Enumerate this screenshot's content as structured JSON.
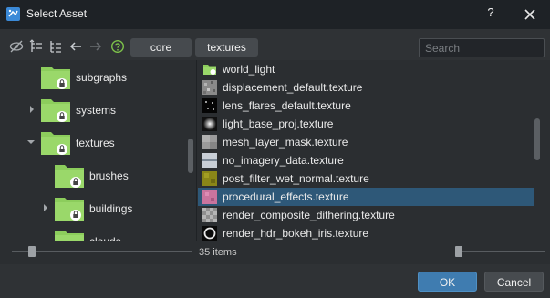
{
  "window": {
    "title": "Select Asset",
    "help_label": "?"
  },
  "toolbar": {
    "icons": [
      "hide-icon",
      "expand-tree-icon",
      "collapse-tree-icon",
      "back-arrow-icon",
      "forward-arrow-icon",
      "help-circle-icon"
    ],
    "breadcrumbs": [
      "core",
      "textures"
    ],
    "search_placeholder": "Search"
  },
  "tree": {
    "items": [
      {
        "label": "subgraphs",
        "expanded": null
      },
      {
        "label": "systems",
        "expanded": false
      },
      {
        "label": "textures",
        "expanded": true
      },
      {
        "label": "brushes",
        "expanded": null
      },
      {
        "label": "buildings",
        "expanded": false
      },
      {
        "label": "clouds",
        "expanded": null
      }
    ]
  },
  "list": {
    "items": [
      {
        "label": "world_light",
        "thumb": "folder"
      },
      {
        "label": "displacement_default.texture",
        "thumb": "noise"
      },
      {
        "label": "lens_flares_default.texture",
        "thumb": "dots"
      },
      {
        "label": "light_base_proj.texture",
        "thumb": "glow"
      },
      {
        "label": "mesh_layer_mask.texture",
        "thumb": "gray"
      },
      {
        "label": "no_imagery_data.texture",
        "thumb": "stripes"
      },
      {
        "label": "post_filter_wet_normal.texture",
        "thumb": "yellow"
      },
      {
        "label": "procedural_effects.texture",
        "thumb": "pink"
      },
      {
        "label": "render_composite_dithering.texture",
        "thumb": "checker"
      },
      {
        "label": "render_hdr_bokeh_iris.texture",
        "thumb": "ring"
      }
    ],
    "selected_index": 7
  },
  "status": {
    "count_label": "35 items"
  },
  "footer": {
    "ok_label": "OK",
    "cancel_label": "Cancel"
  },
  "colors": {
    "accent": "#3f7cb0",
    "selection": "#2e5878",
    "folder_green": "#8ccd5c"
  }
}
